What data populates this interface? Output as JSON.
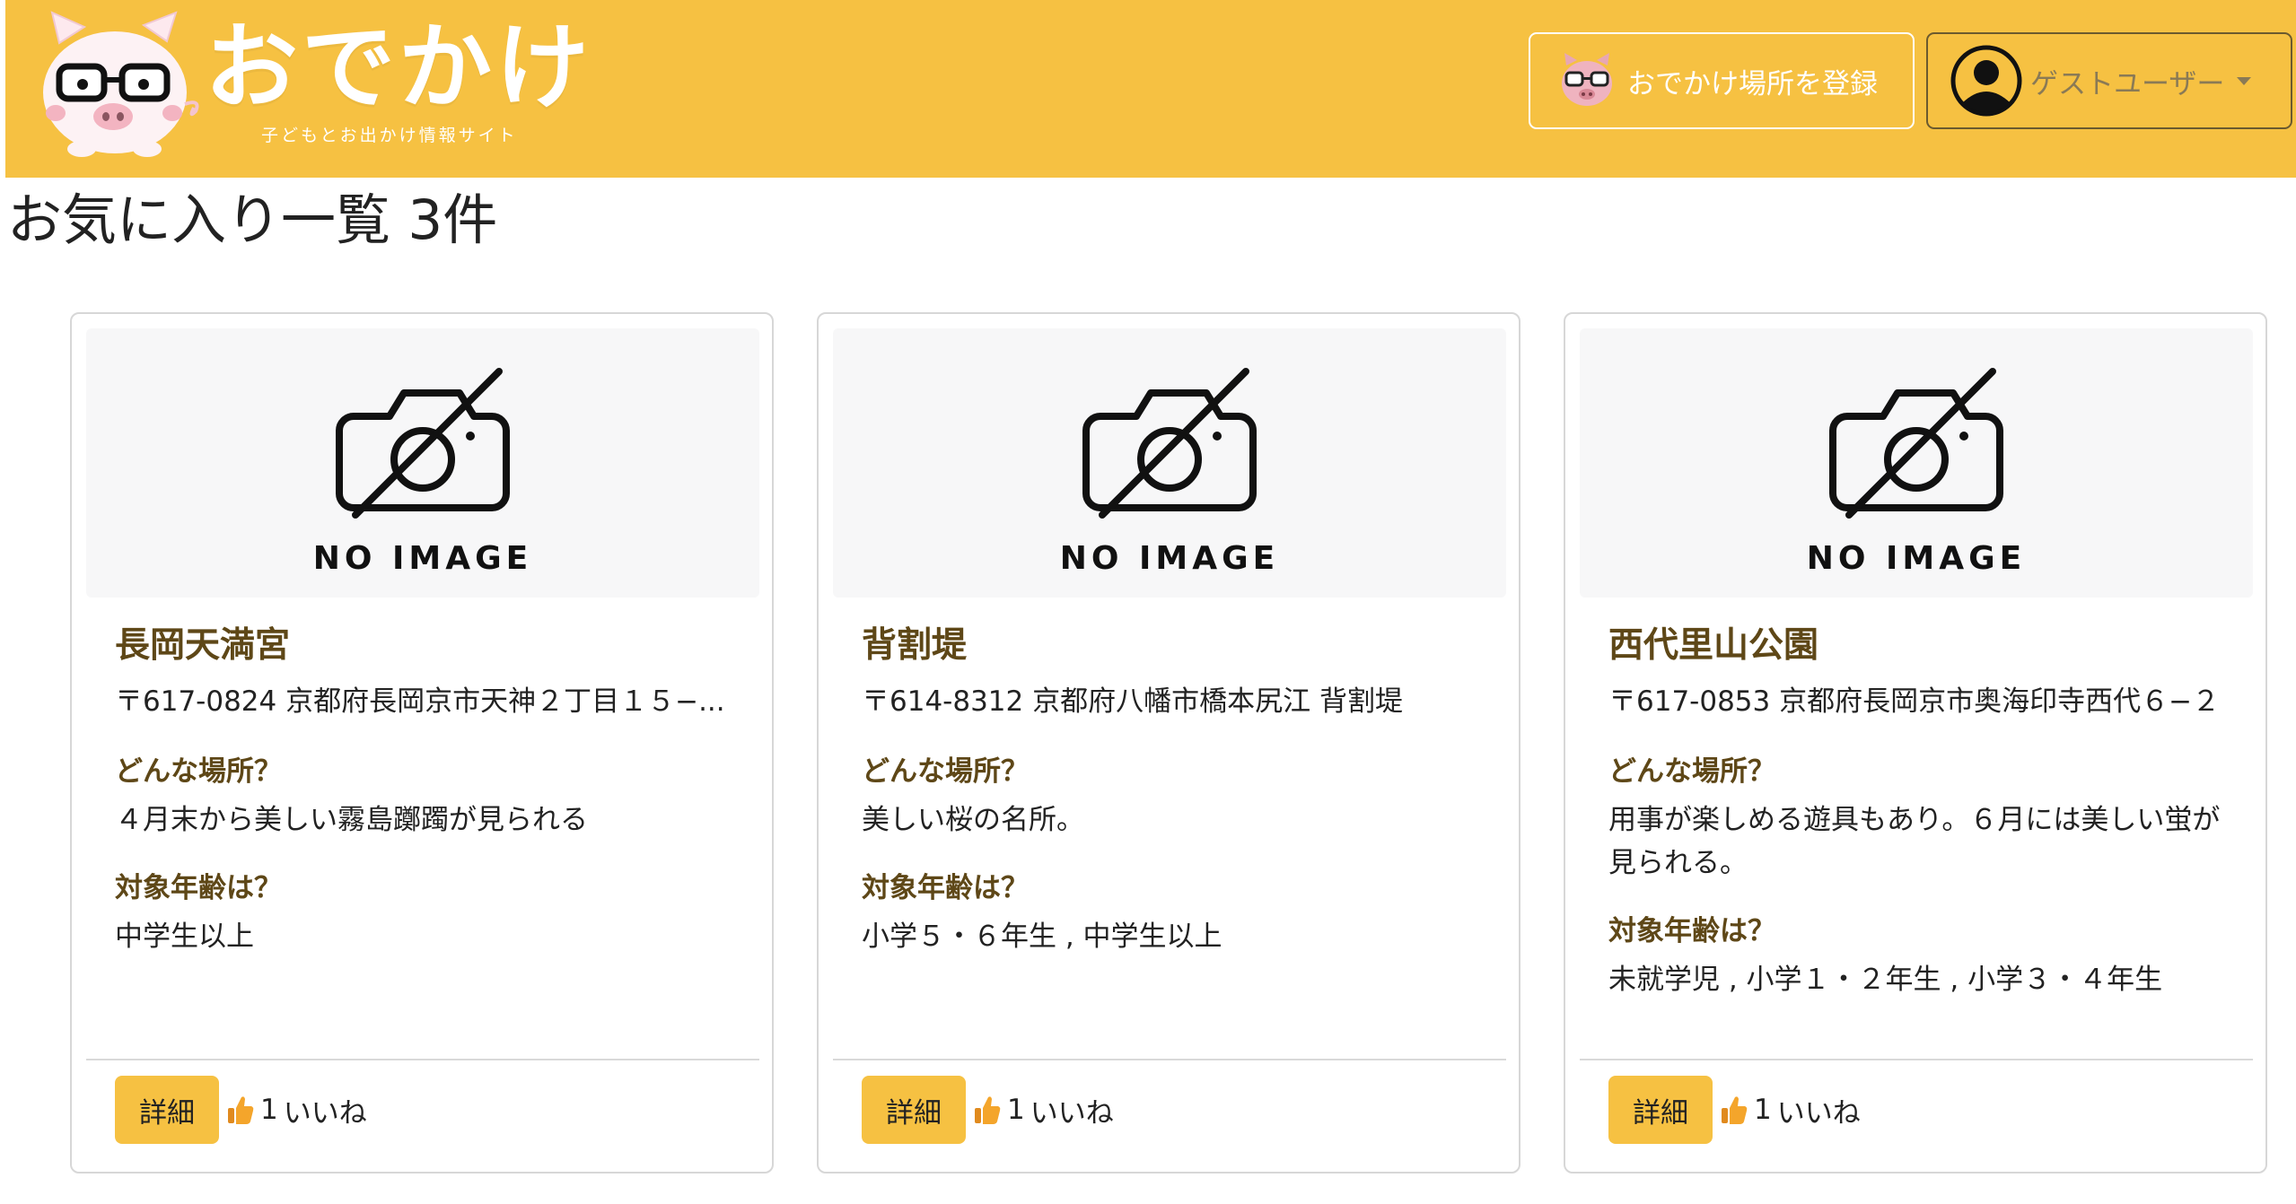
{
  "header": {
    "brand_title": "おでかけ",
    "brand_subtitle": "子どもとお出かけ情報サイト",
    "register_label": "おでかけ場所を登録",
    "user_label": "ゲストユーザー",
    "colors": {
      "navbar": "#f6c142",
      "accent_text": "#5e4717"
    }
  },
  "page": {
    "title": "お気に入り一覧 3件"
  },
  "cards": [
    {
      "no_image_label": "NO IMAGE",
      "name": "長岡天満宮",
      "address": "〒617-0824 京都府長岡京市天神２丁目１５−...",
      "q1_label": "どんな場所？",
      "q1_text": "４月末から美しい霧島躑躅が見られる",
      "q2_label": "対象年齢は？",
      "q2_text": "中学生以上",
      "detail_label": "詳細",
      "like_count": "1",
      "like_label": "いいね"
    },
    {
      "no_image_label": "NO IMAGE",
      "name": "背割堤",
      "address": "〒614-8312 京都府八幡市橋本尻江 背割堤",
      "q1_label": "どんな場所？",
      "q1_text": "美しい桜の名所。",
      "q2_label": "対象年齢は？",
      "q2_text": "小学５・６年生 , 中学生以上",
      "detail_label": "詳細",
      "like_count": "1",
      "like_label": "いいね"
    },
    {
      "no_image_label": "NO IMAGE",
      "name": "西代里山公園",
      "address": "〒617-0853 京都府長岡京市奥海印寺西代６−２",
      "q1_label": "どんな場所？",
      "q1_text": "用事が楽しめる遊具もあり。６月には美しい蛍が見られる。",
      "q2_label": "対象年齢は？",
      "q2_text": "未就学児 , 小学１・２年生 , 小学３・４年生",
      "detail_label": "詳細",
      "like_count": "1",
      "like_label": "いいね"
    }
  ],
  "icons": {
    "logo": "pig-with-glasses-logo",
    "register": "pig-mini-icon",
    "user": "user-circle-icon",
    "caret": "caret-down-icon",
    "camera": "camera-off-icon",
    "like": "thumbs-up-icon"
  }
}
